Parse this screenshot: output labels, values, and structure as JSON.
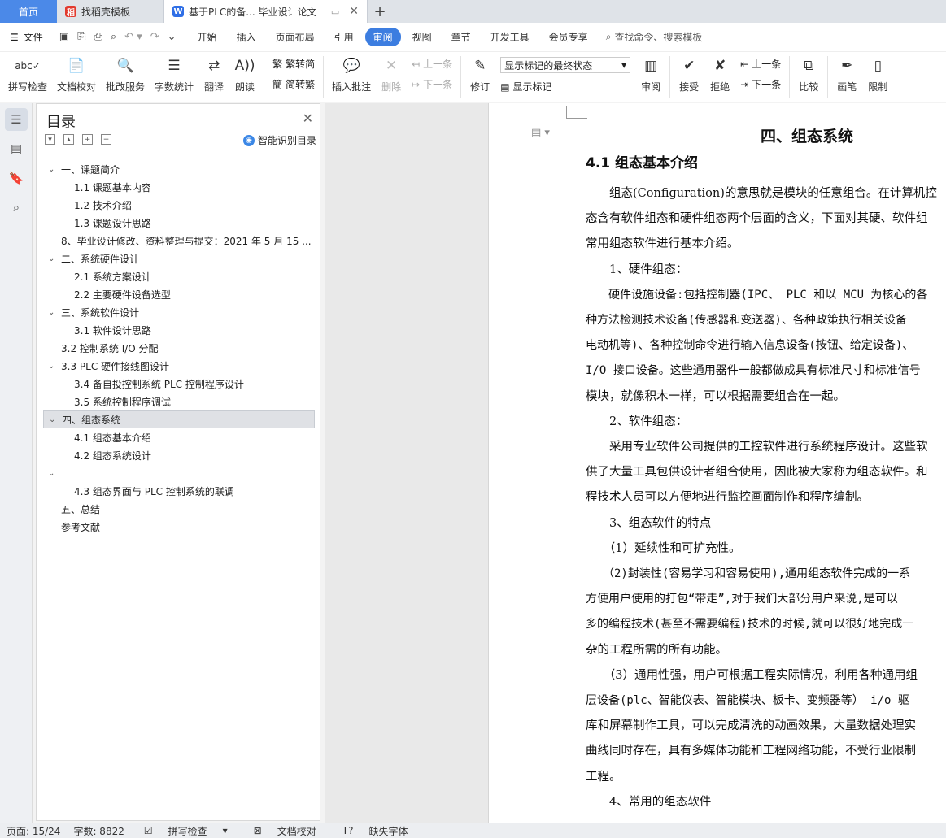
{
  "tabs": {
    "home": "首页",
    "template": "找稻壳模板",
    "document": "基于PLC的备... 毕业设计论文",
    "add": "+"
  },
  "menubar": {
    "file": "文件",
    "items": [
      "开始",
      "插入",
      "页面布局",
      "引用",
      "审阅",
      "视图",
      "章节",
      "开发工具",
      "会员专享"
    ],
    "active": "审阅",
    "search": "查找命令、搜索模板"
  },
  "ribbon": {
    "spellcheck": "拼写检查",
    "doc_check": "文档校对",
    "revise_service": "批改服务",
    "word_count": "字数统计",
    "translate": "翻译",
    "read_aloud": "朗读",
    "to_simplified": "繁转简",
    "to_traditional": "简转繁",
    "insert_comment": "插入批注",
    "delete": "删除",
    "prev": "上一条",
    "next": "下一条",
    "track_changes": "修订",
    "markup_state": "显示标记的最终状态",
    "show_markup": "显示标记",
    "review": "审阅",
    "accept": "接受",
    "reject": "拒绝",
    "prev2": "上一条",
    "next2": "下一条",
    "compare": "比较",
    "pen": "画笔",
    "restrict": "限制"
  },
  "toc": {
    "title": "目录",
    "smart": "智能识别目录",
    "items": [
      {
        "text": "一、课题简介",
        "level": "l1"
      },
      {
        "text": "1.1  课题基本内容",
        "level": "l2"
      },
      {
        "text": "1.2  技术介绍",
        "level": "l2"
      },
      {
        "text": "1.3  课题设计思路",
        "level": "l2"
      },
      {
        "text": "8、毕业设计修改、资料整理与提交：2021 年 5 月 15 ...",
        "level": "l1n"
      },
      {
        "text": "二、系统硬件设计",
        "level": "l1"
      },
      {
        "text": "2.1  系统方案设计",
        "level": "l2"
      },
      {
        "text": "2.2  主要硬件设备选型",
        "level": "l2"
      },
      {
        "text": "三、系统软件设计",
        "level": "l1"
      },
      {
        "text": "3.1  软件设计思路",
        "level": "l2"
      },
      {
        "text": "3.2  控制系统 I/O 分配",
        "level": "l1n"
      },
      {
        "text": "3.3 PLC 硬件接线图设计",
        "level": "l1"
      },
      {
        "text": "3.4 备自投控制系统 PLC 控制程序设计",
        "level": "l2"
      },
      {
        "text": "3.5 系统控制程序调试",
        "level": "l2"
      },
      {
        "text": "四、组态系统",
        "level": "l1",
        "selected": true
      },
      {
        "text": "4.1  组态基本介绍",
        "level": "l2"
      },
      {
        "text": "4.2 组态系统设计",
        "level": "l2"
      },
      {
        "text": "",
        "level": "l1"
      },
      {
        "text": "4.3 组态界面与 PLC 控制系统的联调",
        "level": "l2"
      },
      {
        "text": "五、总结",
        "level": "l1n"
      },
      {
        "text": "参考文献",
        "level": "l1n"
      }
    ]
  },
  "document": {
    "heading1": "四、组态系统",
    "heading2": "4.1  组态基本介绍",
    "lines": [
      {
        "text": "　　组态(Configuration)的意思就是模块的任意组合。在计算机控",
        "mono": false
      },
      {
        "text": "态含有软件组态和硬件组态两个层面的含义，下面对其硬、软件组",
        "mono": false
      },
      {
        "text": "常用组态软件进行基本介绍。",
        "mono": false
      },
      {
        "text": "　　1、硬件组态：",
        "mono": false
      },
      {
        "text": "　　硬件设施设备:包括控制器(IPC、 PLC 和以 MCU 为核心的各",
        "mono": true
      },
      {
        "text": "种方法检测技术设备(传感器和变送器)、各种政策执行相关设备",
        "mono": true
      },
      {
        "text": "电动机等)、各种控制命令进行输入信息设备(按钮、给定设备)、",
        "mono": true
      },
      {
        "text": "I/O 接口设备。这些通用器件一般都做成具有标准尺寸和标准信号",
        "mono": true
      },
      {
        "text": "模块，就像积木一样，可以根据需要组合在一起。",
        "mono": false
      },
      {
        "text": "　　2、软件组态：",
        "mono": false
      },
      {
        "text": "　　采用专业软件公司提供的工控软件进行系统程序设计。这些软",
        "mono": false
      },
      {
        "text": "供了大量工具包供设计者组合使用，因此被大家称为组态软件。和",
        "mono": false
      },
      {
        "text": "程技术人员可以方便地进行监控画面制作和程序编制。",
        "mono": false
      },
      {
        "text": "　　3、组态软件的特点",
        "mono": false
      },
      {
        "text": "　　（1）延续性和可扩充性。",
        "mono": false
      },
      {
        "text": "　　（2)封装性(容易学习和容易使用),通用组态软件完成的一系",
        "mono": true
      },
      {
        "text": "方便用户使用的打包“带走”,对于我们大部分用户来说,是可以",
        "mono": true
      },
      {
        "text": "多的编程技术(甚至不需要编程)技术的时候,就可以很好地完成一",
        "mono": true
      },
      {
        "text": "杂的工程所需的所有功能。",
        "mono": false
      },
      {
        "text": "　　（3）通用性强，用户可根据工程实际情况，利用各种通用组",
        "mono": false
      },
      {
        "text": "层设备(plc、智能仪表、智能模块、板卡、变频器等） i/o  驱",
        "mono": true
      },
      {
        "text": "库和屏幕制作工具，可以完成清洗的动画效果，大量数据处理实",
        "mono": false
      },
      {
        "text": "曲线同时存在，具有多媒体功能和工程网络功能，不受行业限制",
        "mono": false
      },
      {
        "text": "工程。",
        "mono": false
      },
      {
        "text": "　　4、常用的组态软件",
        "mono": false
      }
    ]
  },
  "status": {
    "page": "页面: 15/24",
    "words": "字数: 8822",
    "spellcheck": "拼写检查",
    "doccheck": "文档校对",
    "missing_font": "缺失字体"
  }
}
